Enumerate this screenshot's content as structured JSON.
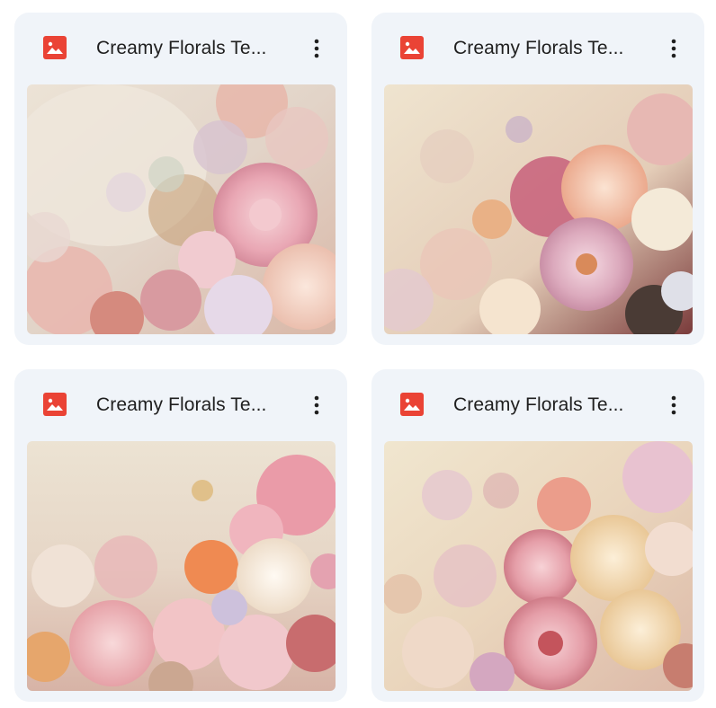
{
  "files": [
    {
      "title": "Creamy Florals Te...",
      "icon": "image-file-icon",
      "menu_icon": "more-vert-icon",
      "thumbnail": "floral-thumbnail"
    },
    {
      "title": "Creamy Florals Te...",
      "icon": "image-file-icon",
      "menu_icon": "more-vert-icon",
      "thumbnail": "floral-thumbnail"
    },
    {
      "title": "Creamy Florals Te...",
      "icon": "image-file-icon",
      "menu_icon": "more-vert-icon",
      "thumbnail": "floral-thumbnail"
    },
    {
      "title": "Creamy Florals Te...",
      "icon": "image-file-icon",
      "menu_icon": "more-vert-icon",
      "thumbnail": "floral-thumbnail"
    }
  ],
  "colors": {
    "card_bg": "#f0f4f9",
    "image_icon": "#ea4335",
    "title_text": "#1f1f1f"
  }
}
